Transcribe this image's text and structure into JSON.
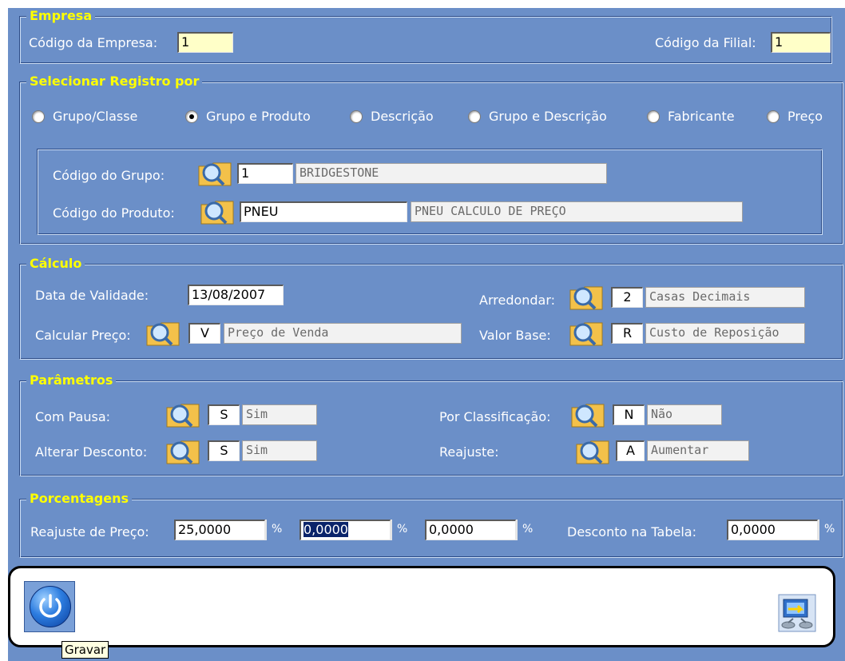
{
  "empresa": {
    "legend": "Empresa",
    "codigo_empresa_label": "Código da Empresa:",
    "codigo_empresa_value": "1",
    "codigo_filial_label": "Código da Filial:",
    "codigo_filial_value": "1"
  },
  "selecionar": {
    "legend": "Selecionar Registro por",
    "options": [
      "Grupo/Classe",
      "Grupo e Produto",
      "Descrição",
      "Grupo e Descrição",
      "Fabricante",
      "Preço"
    ],
    "selected": "Grupo e Produto",
    "grupo_label": "Código do Grupo:",
    "grupo_code": "1",
    "grupo_desc": "BRIDGESTONE",
    "produto_label": "Código do Produto:",
    "produto_code": "PNEU",
    "produto_desc": "PNEU CALCULO DE PREÇO"
  },
  "calculo": {
    "legend": "Cálculo",
    "data_validade_label": "Data de Validade:",
    "data_validade_value": "13/08/2007",
    "calcular_preco_label": "Calcular Preço:",
    "calcular_preco_code": "V",
    "calcular_preco_desc": "Preço de Venda",
    "arredondar_label": "Arredondar:",
    "arredondar_code": "2",
    "arredondar_desc": "Casas Decimais",
    "valor_base_label": "Valor Base:",
    "valor_base_code": "R",
    "valor_base_desc": "Custo de Reposição"
  },
  "parametros": {
    "legend": "Parâmetros",
    "com_pausa_label": "Com Pausa:",
    "com_pausa_code": "S",
    "com_pausa_desc": "Sim",
    "alterar_desconto_label": "Alterar Desconto:",
    "alterar_desconto_code": "S",
    "alterar_desconto_desc": "Sim",
    "por_classificacao_label": "Por Classificação:",
    "por_classificacao_code": "N",
    "por_classificacao_desc": "Não",
    "reajuste_label": "Reajuste:",
    "reajuste_code": "A",
    "reajuste_desc": "Aumentar"
  },
  "porcentagens": {
    "legend": "Porcentagens",
    "reajuste_preco_label": "Reajuste de Preço:",
    "reajuste_preco_1": "25,0000",
    "reajuste_preco_2": "0,0000",
    "reajuste_preco_3": "0,0000",
    "percent_symbol": "%",
    "desconto_tabela_label": "Desconto na Tabela:",
    "desconto_tabela_value": "0,0000"
  },
  "toolbar": {
    "tooltip": "Gravar"
  },
  "colors": {
    "panel": "#6b8fc8",
    "legend": "#ffff00",
    "selection": "#0a246a"
  },
  "icons": {
    "lookup": "folder-magnifier-icon",
    "power": "power-icon",
    "network": "network-transfer-icon"
  }
}
